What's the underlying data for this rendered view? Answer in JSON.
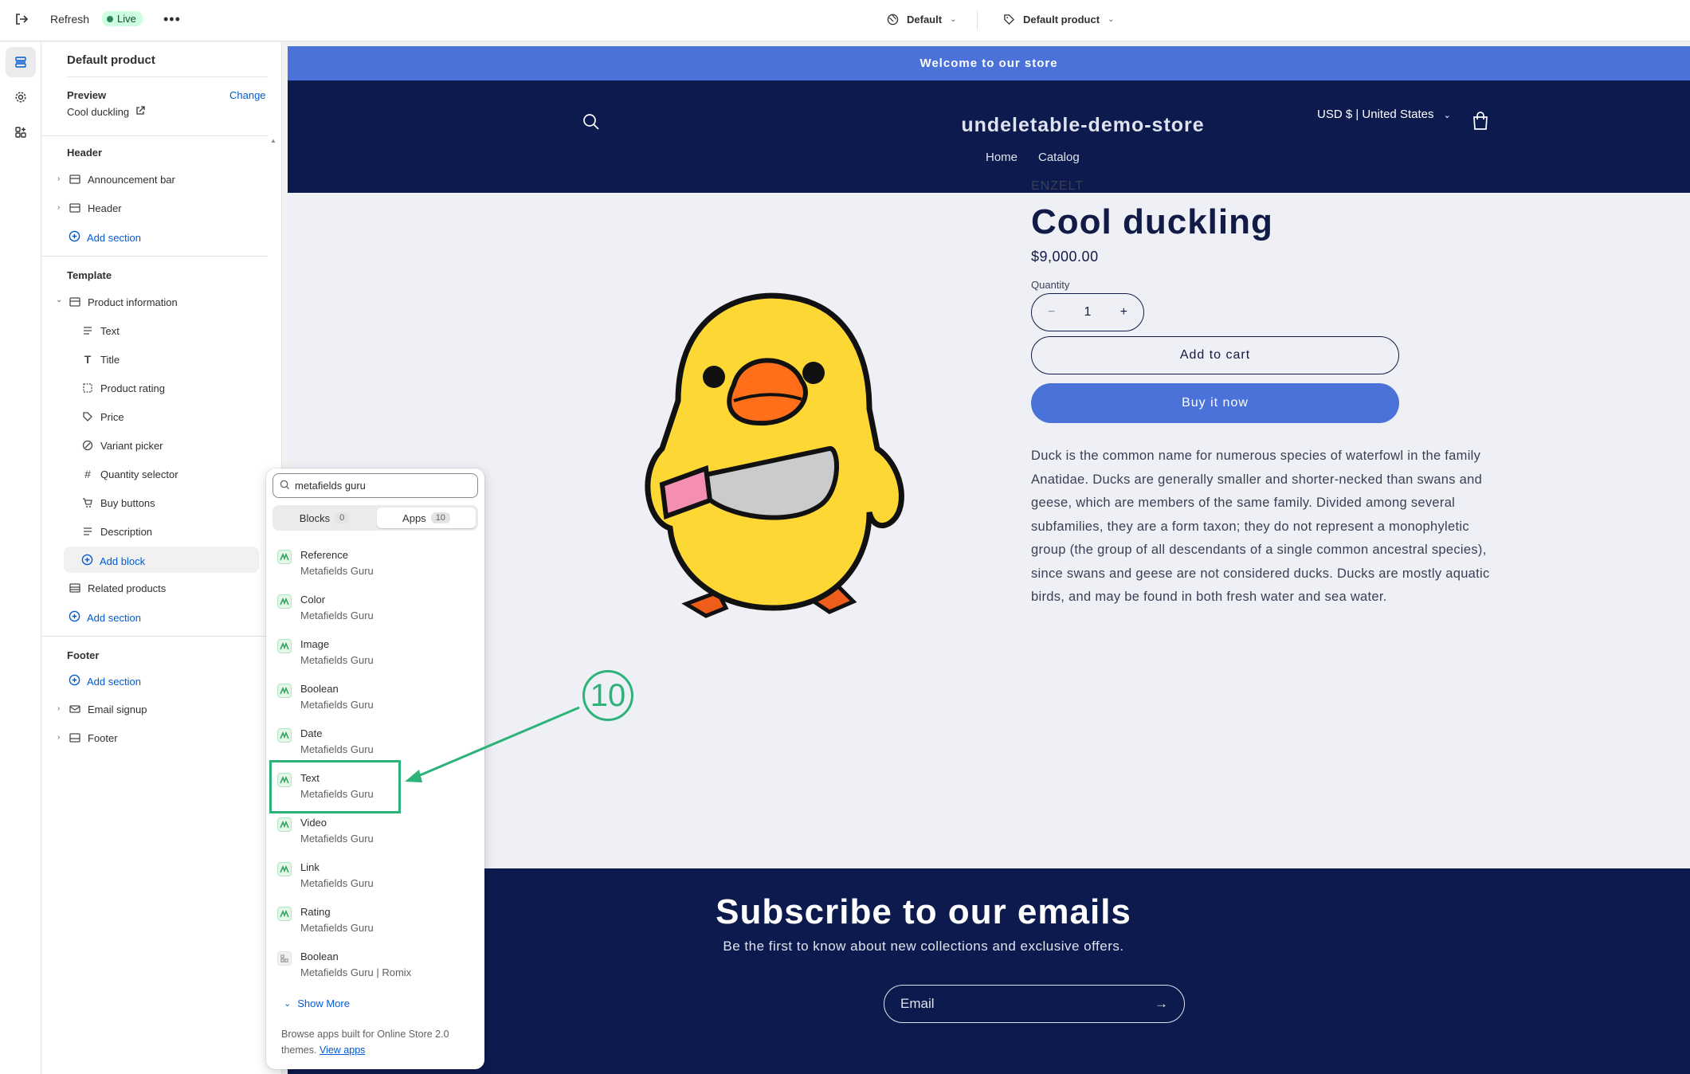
{
  "topbar": {
    "refresh_label": "Refresh",
    "live_label": "Live",
    "theme_label": "Default",
    "template_label": "Default product"
  },
  "sidebar": {
    "title": "Default product",
    "preview": {
      "label": "Preview",
      "change_label": "Change",
      "value": "Cool duckling"
    },
    "header_group": {
      "label": "Header",
      "items": [
        "Announcement bar",
        "Header"
      ],
      "add_section": "Add section"
    },
    "template_group": {
      "label": "Template",
      "section": "Product information",
      "blocks": [
        "Text",
        "Title",
        "Product rating",
        "Price",
        "Variant picker",
        "Quantity selector",
        "Buy buttons",
        "Description"
      ],
      "add_block": "Add block",
      "related": "Related products",
      "add_section": "Add section"
    },
    "footer_group": {
      "label": "Footer",
      "add_section": "Add section",
      "items": [
        "Email signup",
        "Footer"
      ]
    }
  },
  "picker": {
    "search_value": "metafields guru",
    "tabs": [
      {
        "label": "Blocks",
        "count": "0"
      },
      {
        "label": "Apps",
        "count": "10"
      }
    ],
    "items": [
      {
        "name": "Reference",
        "vendor": "Metafields Guru"
      },
      {
        "name": "Color",
        "vendor": "Metafields Guru"
      },
      {
        "name": "Image",
        "vendor": "Metafields Guru"
      },
      {
        "name": "Boolean",
        "vendor": "Metafields Guru"
      },
      {
        "name": "Date",
        "vendor": "Metafields Guru"
      },
      {
        "name": "Text",
        "vendor": "Metafields Guru"
      },
      {
        "name": "Video",
        "vendor": "Metafields Guru"
      },
      {
        "name": "Link",
        "vendor": "Metafields Guru"
      },
      {
        "name": "Rating",
        "vendor": "Metafields Guru"
      },
      {
        "name": "Boolean",
        "vendor": "Metafields Guru | Romix"
      }
    ],
    "show_more": "Show More",
    "browse_text": "Browse apps built for Online Store 2.0 themes.",
    "view_apps": "View apps"
  },
  "callout": {
    "number": "10",
    "color": "#2db37a"
  },
  "store": {
    "announcement": "Welcome to our store",
    "name": "undeletable-demo-store",
    "currency": "USD $ | United States",
    "nav": [
      "Home",
      "Catalog"
    ],
    "product": {
      "vendor": "ENZELT",
      "title": "Cool duckling",
      "price": "$9,000.00",
      "quantity_label": "Quantity",
      "quantity": "1",
      "add_to_cart": "Add to cart",
      "buy_now": "Buy it now",
      "description": "Duck is the common name for numerous species of waterfowl in the family Anatidae. Ducks are generally smaller and shorter-necked than swans and geese, which are members of the same family. Divided among several subfamilies, they are a form taxon; they do not represent a monophyletic group (the group of all descendants of a single common ancestral species), since swans and geese are not considered ducks. Ducks are mostly aquatic birds, and may be found in both fresh water and sea water."
    },
    "newsletter": {
      "title": "Subscribe to our emails",
      "text": "Be the first to know about new collections and exclusive offers.",
      "email_placeholder": "Email"
    },
    "colors": {
      "accent": "#4a72d9",
      "navy": "#0c1a4e"
    }
  }
}
